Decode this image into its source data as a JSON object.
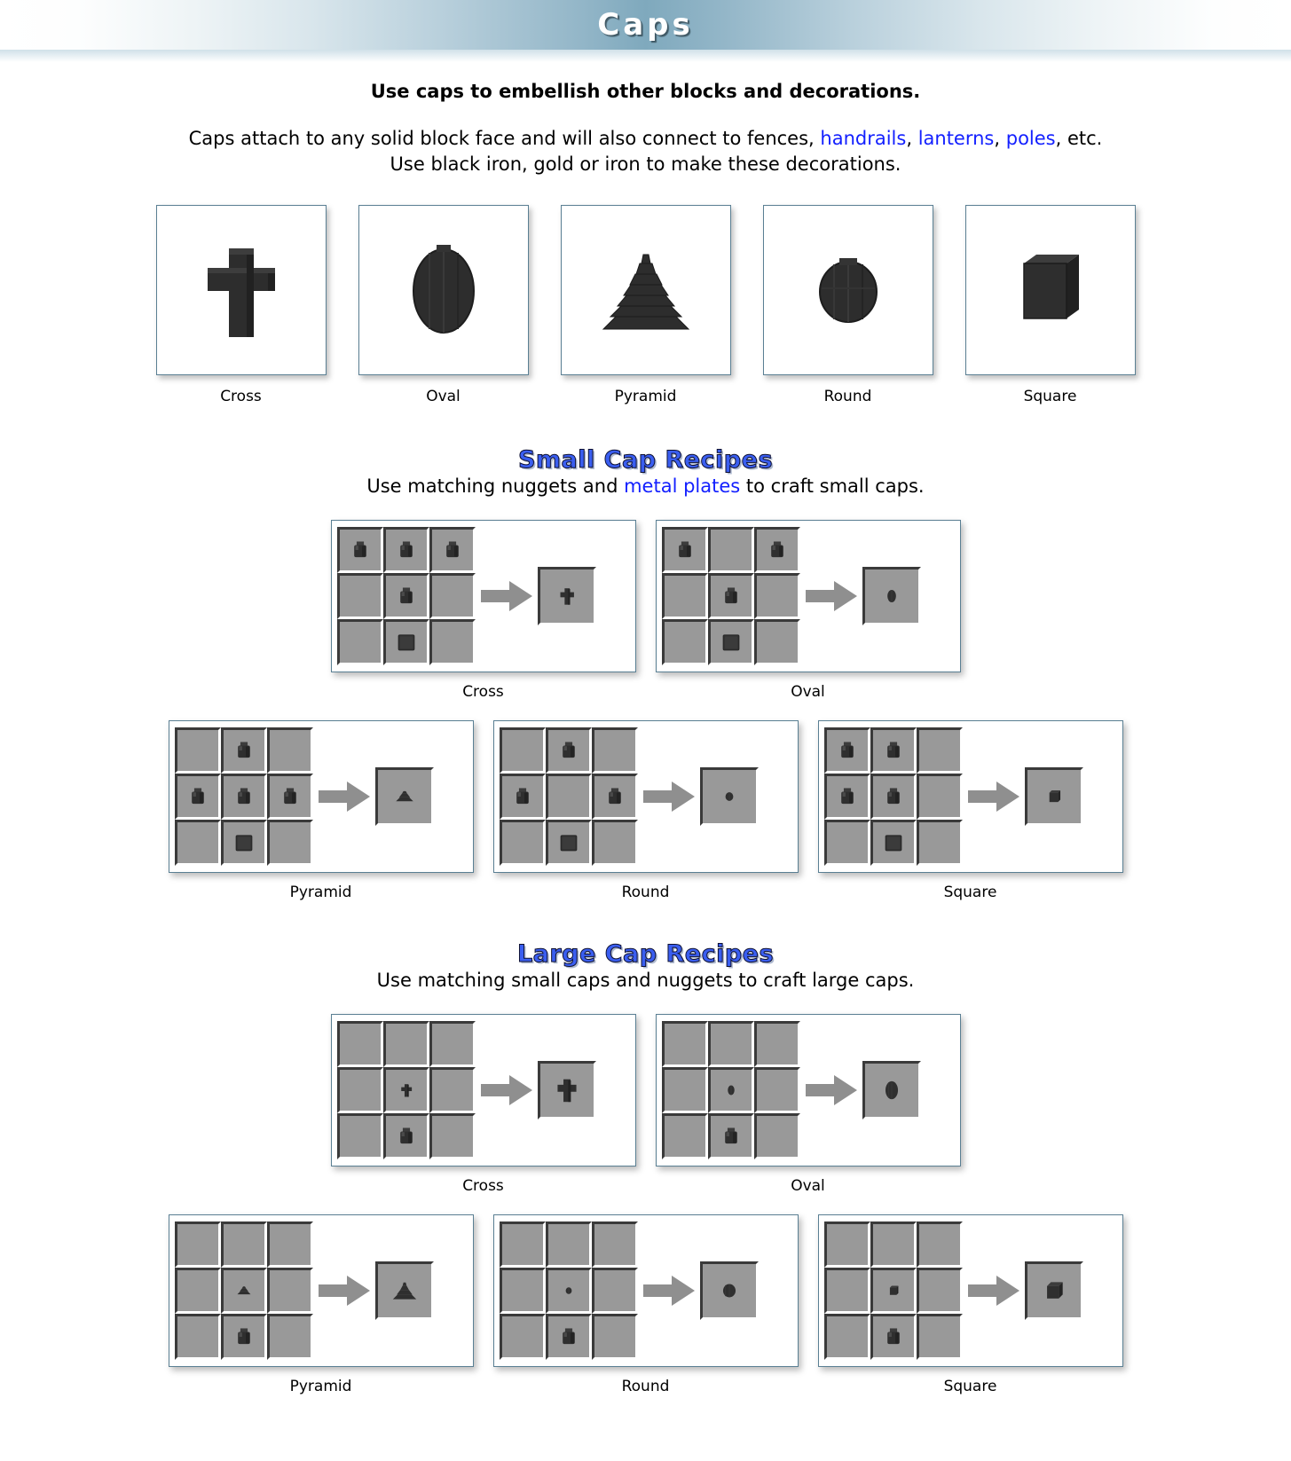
{
  "banner": {
    "title": "Caps"
  },
  "intro": {
    "lead": "Use caps to embellish other blocks and decorations.",
    "line1_a": "Caps attach to any solid block face and will also connect to fences, ",
    "link_handrails": "handrails",
    "sep1": ", ",
    "link_lanterns": "lanterns",
    "sep2": ", ",
    "link_poles": "poles",
    "line1_b": ", etc.",
    "line2": "Use black iron, gold or iron to make these decorations."
  },
  "gallery": {
    "items": [
      {
        "label": "Cross",
        "icon": "cross-cap-icon"
      },
      {
        "label": "Oval",
        "icon": "oval-cap-icon"
      },
      {
        "label": "Pyramid",
        "icon": "pyramid-cap-icon"
      },
      {
        "label": "Round",
        "icon": "round-cap-icon"
      },
      {
        "label": "Square",
        "icon": "square-cap-icon"
      }
    ]
  },
  "small_section": {
    "heading": "Small Cap Recipes",
    "sub_a": "Use matching nuggets and ",
    "sub_link": "metal plates",
    "sub_b": " to craft small caps.",
    "recipes": [
      {
        "label": "Cross",
        "grid": [
          "nugget",
          "nugget",
          "nugget",
          "",
          "nugget",
          "",
          "",
          "plate",
          ""
        ],
        "result": "small-cross-cap"
      },
      {
        "label": "Oval",
        "grid": [
          "nugget",
          "",
          "nugget",
          "",
          "nugget",
          "",
          "",
          "plate",
          ""
        ],
        "result": "small-oval-cap"
      },
      {
        "label": "Pyramid",
        "grid": [
          "",
          "nugget",
          "",
          "nugget",
          "nugget",
          "nugget",
          "",
          "plate",
          ""
        ],
        "result": "small-pyramid-cap"
      },
      {
        "label": "Round",
        "grid": [
          "",
          "nugget",
          "",
          "nugget",
          "",
          "nugget",
          "",
          "plate",
          ""
        ],
        "result": "small-round-cap"
      },
      {
        "label": "Square",
        "grid": [
          "nugget",
          "nugget",
          "",
          "nugget",
          "nugget",
          "",
          "",
          "plate",
          ""
        ],
        "result": "small-square-cap"
      }
    ]
  },
  "large_section": {
    "heading": "Large Cap Recipes",
    "sub": "Use matching small caps and nuggets to craft large caps.",
    "recipes": [
      {
        "label": "Cross",
        "grid": [
          "",
          "",
          "",
          "",
          "small-cross-cap",
          "",
          "",
          "nugget",
          ""
        ],
        "result": "large-cross-cap"
      },
      {
        "label": "Oval",
        "grid": [
          "",
          "",
          "",
          "",
          "small-oval-cap",
          "",
          "",
          "nugget",
          ""
        ],
        "result": "large-oval-cap"
      },
      {
        "label": "Pyramid",
        "grid": [
          "",
          "",
          "",
          "",
          "small-pyramid-cap",
          "",
          "",
          "nugget",
          ""
        ],
        "result": "large-pyramid-cap"
      },
      {
        "label": "Round",
        "grid": [
          "",
          "",
          "",
          "",
          "small-round-cap",
          "",
          "",
          "nugget",
          ""
        ],
        "result": "large-round-cap"
      },
      {
        "label": "Square",
        "grid": [
          "",
          "",
          "",
          "",
          "small-square-cap",
          "",
          "",
          "nugget",
          ""
        ],
        "result": "large-square-cap"
      }
    ]
  },
  "colors": {
    "link": "#1320ff",
    "heading": "#3a5ef0",
    "slot_bg": "#999999",
    "item_dark": "#2d2d2d",
    "panel_border": "#5a7f93"
  },
  "icons": {
    "arrow": "right-arrow-icon"
  }
}
